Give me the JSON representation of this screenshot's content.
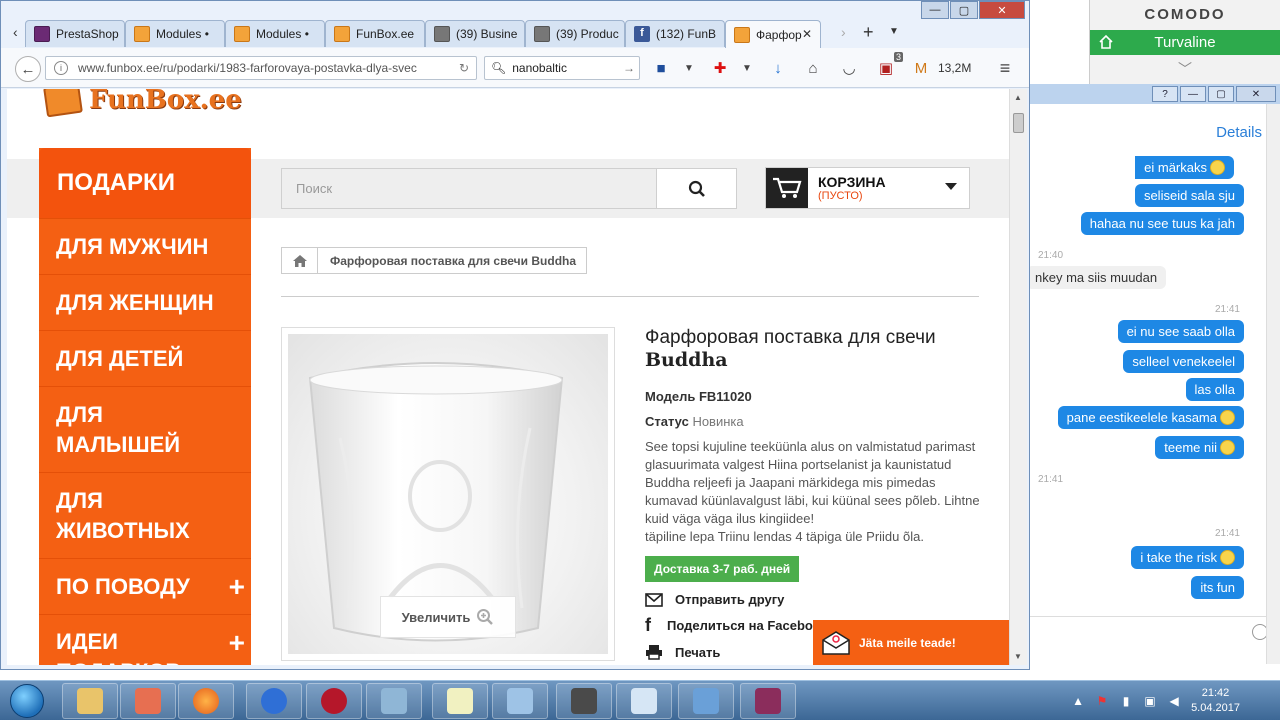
{
  "comodo": {
    "brand": "COMODO",
    "status": "Turvaline",
    "icons": [
      "home-icon",
      "chevron-down-icon"
    ],
    "accent": "#2daa4c"
  },
  "browser": {
    "tabs": [
      {
        "label": "PrestaShop",
        "icon": "prestashop-favicon"
      },
      {
        "label": "Modules •",
        "icon": "funbox-favicon"
      },
      {
        "label": "Modules •",
        "icon": "funbox-favicon"
      },
      {
        "label": "FunBox.ee",
        "icon": "funbox-favicon"
      },
      {
        "label": "(39) Busine",
        "icon": "image-favicon"
      },
      {
        "label": "(39) Produc",
        "icon": "image-favicon"
      },
      {
        "label": "(132) FunB",
        "icon": "facebook-favicon"
      },
      {
        "label": "Фарфор",
        "icon": "funbox-favicon",
        "active": true
      }
    ],
    "url": "www.funbox.ee/ru/podarki/1983-farforovaya-postavka-dlya-svec",
    "search_value": "nanobaltic",
    "download_size": "13,2M",
    "addon_badge": "3"
  },
  "site": {
    "logo_text": "FunBox.ee",
    "menu_title": "ПОДАРКИ",
    "menu_items": [
      {
        "label": "ДЛЯ МУЖЧИН",
        "plus": false
      },
      {
        "label": "ДЛЯ ЖЕНЩИН",
        "plus": false
      },
      {
        "label": "ДЛЯ ДЕТЕЙ",
        "plus": false
      },
      {
        "label": "ДЛЯ МАЛЫШЕЙ",
        "plus": false
      },
      {
        "label": "ДЛЯ ЖИВОТНЫХ",
        "plus": false
      },
      {
        "label": "ПО ПОВОДУ",
        "plus": true
      },
      {
        "label": "ИДЕИ ПОДАРКОВ",
        "plus": true
      }
    ],
    "search_placeholder": "Поиск",
    "cart_title": "КОРЗИНА",
    "cart_status": "(ПУСТО)",
    "breadcrumb": "Фарфоровая поставка для свечи Buddha",
    "zoom_label": "Увеличить",
    "product": {
      "title_line1": "Фарфоровая поставка для свечи",
      "title_line2": "Buddha",
      "model_label": "Модель",
      "model_value": "FB11020",
      "status_label": "Статус",
      "status_value": "Новинка",
      "description": "See topsi kujuline teeküünla alus on valmistatud parimast glasuurimata valgest Hiina portselanist ja kaunistatud Buddha reljeefi ja Jaapani märkidega mis pimedas kumavad küünlavalgust läbi, kui küünal sees põleb. Lihtne kuid väga väga ilus kingiidee!",
      "description_note": "täpiline lepa Triinu lendas 4 täpiga üle Priidu õla.",
      "delivery": "Доставка 3-7 раб. дней",
      "actions": [
        "Отправить другу",
        "Поделиться на Facebook!",
        "Печать"
      ]
    },
    "chat_button": "Jäta meile teade!",
    "colors": {
      "orange": "#f46013",
      "green": "#4cae4c"
    }
  },
  "chat": {
    "details": "Details",
    "messages": [
      {
        "text": "ei märkaks",
        "dir": "out",
        "emoji": true
      },
      {
        "text": "seliseid sala sju",
        "dir": "out"
      },
      {
        "text": "hahaa nu see tuus ka jah",
        "dir": "out"
      },
      {
        "text": "21:40",
        "dir": "time"
      },
      {
        "text": "nkey ma siis muudan",
        "dir": "in"
      },
      {
        "text": "21:41",
        "dir": "time"
      },
      {
        "text": "ei nu see saab olla",
        "dir": "out"
      },
      {
        "text": "selleel venekeelel",
        "dir": "out"
      },
      {
        "text": "las olla",
        "dir": "out"
      },
      {
        "text": "pane eestikeelele kasama",
        "dir": "out",
        "emoji": true
      },
      {
        "text": "teeme nii",
        "dir": "out",
        "emoji": true
      },
      {
        "text": "21:41",
        "dir": "time"
      },
      {
        "text": "21:41",
        "dir": "time"
      },
      {
        "text": "i take the risk",
        "dir": "out",
        "emoji": true
      },
      {
        "text": "its fun",
        "dir": "out"
      }
    ]
  },
  "taskbar": {
    "time": "21:42",
    "date": "5.04.2017"
  }
}
